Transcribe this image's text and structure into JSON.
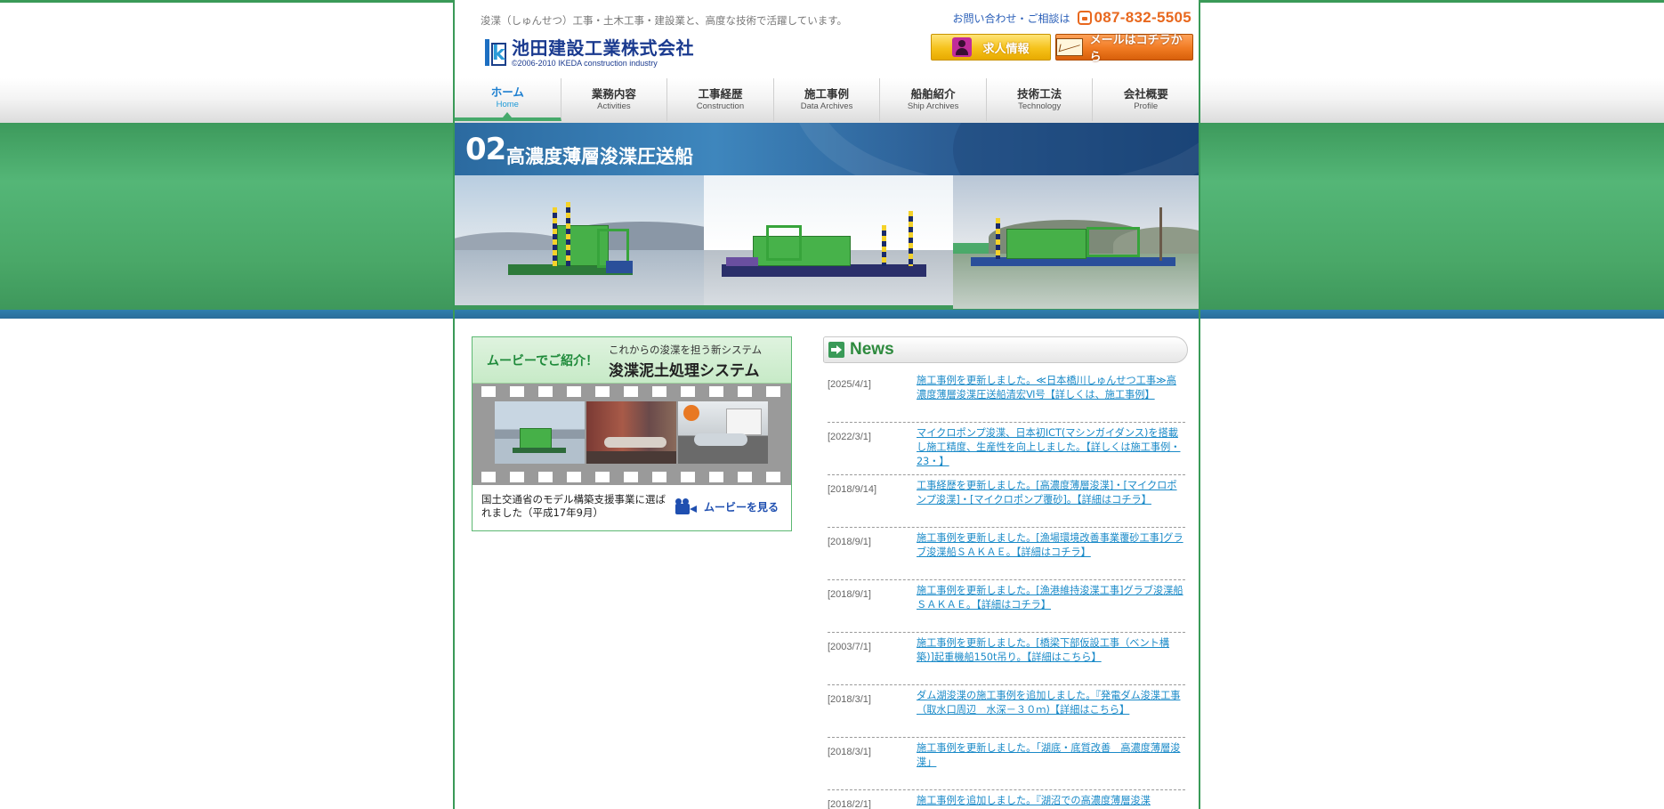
{
  "header": {
    "tagline": "浚渫（しゅんせつ）工事・土木工事・建設業と、高度な技術で活躍しています。",
    "logo_name": "池田建設工業株式会社",
    "logo_copyright": "©2006-2010 IKEDA construction industry",
    "contact_label": "お問い合わせ・ご相談は",
    "phone": "087-832-5505",
    "recruit_button": "求人情報",
    "mail_button": "メールはコチラから"
  },
  "nav": [
    {
      "jp": "ホーム",
      "en": "Home",
      "active": true
    },
    {
      "jp": "業務内容",
      "en": "Activities"
    },
    {
      "jp": "工事経歴",
      "en": "Construction"
    },
    {
      "jp": "施工事例",
      "en": "Data Archives"
    },
    {
      "jp": "船舶紹介",
      "en": "Ship Archives"
    },
    {
      "jp": "技術工法",
      "en": "Technology"
    },
    {
      "jp": "会社概要",
      "en": "Profile"
    }
  ],
  "hero": {
    "number": "02",
    "title": "高濃度薄層浚渫圧送船"
  },
  "movie": {
    "label": "ムービーでご紹介！",
    "subtitle": "これからの浚渫を担う新システム",
    "title": "浚渫泥土処理システム",
    "caption": "国土交通省のモデル構築支援事業に選ばれました（平成17年9月）",
    "link": "ムービーを見る"
  },
  "news": {
    "title": "News",
    "items": [
      {
        "date": "[2025/4/1]",
        "text": "施工事例を更新しました。≪日本橋川しゅんせつ工事≫高濃度薄層浚渫圧送船清宏Ⅵ号【詳しくは、施工事例】"
      },
      {
        "date": "[2022/3/1]",
        "text": "マイクロポンプ浚渫、日本初ICT(マシンガイダンス)を搭載し施工精度、生産性を向上しました。【詳しくは施工事例・23・】"
      },
      {
        "date": "[2018/9/14]",
        "text": "工事経歴を更新しました。[高濃度薄層浚渫]・[マイクロポンプ浚渫]・[マイクロポンプ覆砂]。【詳細はコチラ】"
      },
      {
        "date": "[2018/9/1]",
        "text": "施工事例を更新しました。[漁場環境改善事業覆砂工事]グラブ浚渫船ＳＡＫＡＥ。【詳細はコチラ】"
      },
      {
        "date": "[2018/9/1]",
        "text": "施工事例を更新しました。[漁港維持浚渫工事]グラブ浚渫船ＳＡＫＡＥ。【詳細はコチラ】"
      },
      {
        "date": "[2003/7/1]",
        "text": "施工事例を更新しました。[橋梁下部仮設工事（ベント構築)]起重機船150t吊り。【詳細はこちら】"
      },
      {
        "date": "[2018/3/1]",
        "text": "ダム湖浚渫の施工事例を追加しました。『発電ダム浚渫工事（取水口周辺　水深－３０ｍ)【詳細はこちら】"
      },
      {
        "date": "[2018/3/1]",
        "text": "施工事例を更新しました。「湖底・底質改善　高濃度薄層浚渫」"
      },
      {
        "date": "[2018/2/1]",
        "text": "施工事例を追加しました。『湖沼での高濃度薄層浚渫"
      }
    ]
  },
  "colors": {
    "brand_green": "#3a9a58",
    "link_blue": "#1a8ac8",
    "phone_orange": "#e8681e"
  }
}
